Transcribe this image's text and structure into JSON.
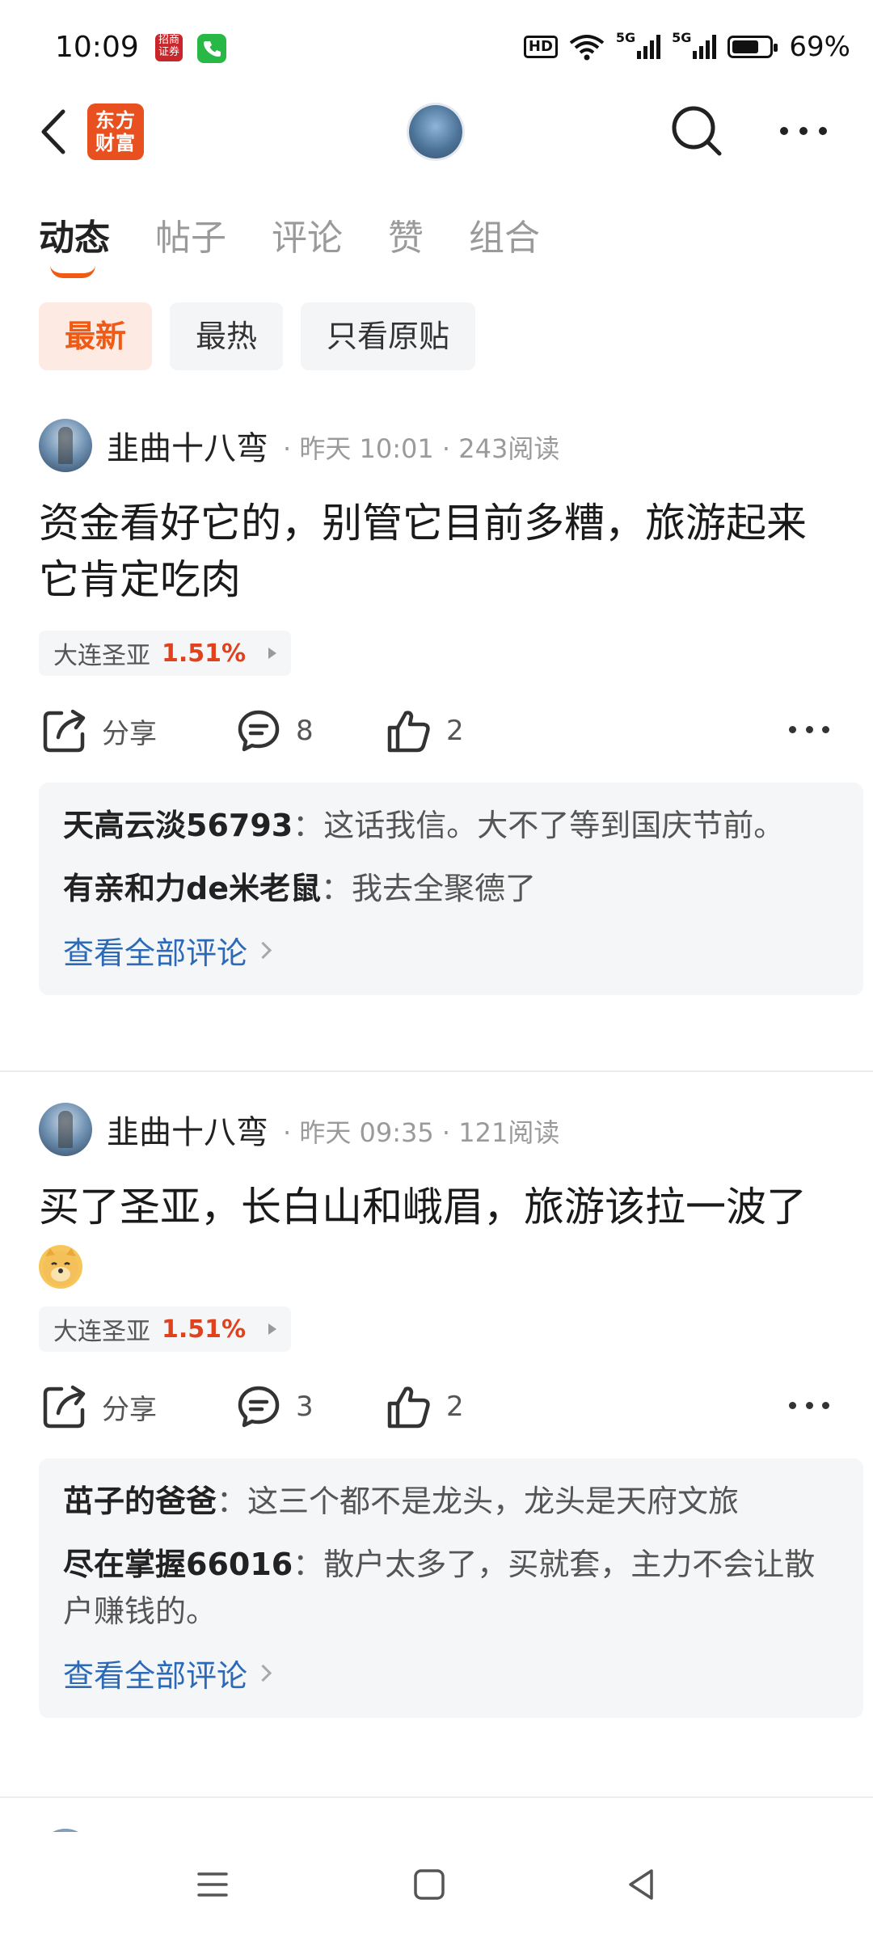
{
  "status_bar": {
    "time": "10:09",
    "notif_text": "招商证券",
    "hd_label": "HD",
    "net1": "5G",
    "net2": "5G",
    "battery": "69%"
  },
  "header": {
    "brand_line1": "东方",
    "brand_line2": "财富"
  },
  "tabs": [
    {
      "label": "动态",
      "active": true
    },
    {
      "label": "帖子"
    },
    {
      "label": "评论"
    },
    {
      "label": "赞"
    },
    {
      "label": "组合"
    }
  ],
  "filters": [
    {
      "label": "最新",
      "active": true
    },
    {
      "label": "最热"
    },
    {
      "label": "只看原贴"
    }
  ],
  "posts": [
    {
      "author": "韭曲十八弯",
      "meta": "· 昨天 10:01 · 243阅读",
      "content": "资金看好它的，别管它目前多糟，旅游起来它肯定吃肉",
      "stock_name": "大连圣亚",
      "stock_pct": "1.51%",
      "share_label": "分享",
      "comment_count": "8",
      "like_count": "2",
      "comments": [
        {
          "user": "天高云淡56793",
          "text": "这话我信。大不了等到国庆节前。"
        },
        {
          "user": "有亲和力de米老鼠",
          "text": "我去全聚德了"
        }
      ],
      "view_all": "查看全部评论"
    },
    {
      "author": "韭曲十八弯",
      "meta": "· 昨天 09:35 · 121阅读",
      "content": "买了圣亚，长白山和峨眉，旅游该拉一波了",
      "stock_name": "大连圣亚",
      "stock_pct": "1.51%",
      "share_label": "分享",
      "comment_count": "3",
      "like_count": "2",
      "comments": [
        {
          "user": "茁子的爸爸",
          "text": "这三个都不是龙头，龙头是天府文旅"
        },
        {
          "user": "尽在掌握66016",
          "text": "散户太多了，买就套，主力不会让散户赚钱的。"
        }
      ],
      "view_all": "查看全部评论"
    }
  ],
  "colors": {
    "accent": "#f05a14",
    "link": "#2c6ab8",
    "up": "#e0421e"
  }
}
